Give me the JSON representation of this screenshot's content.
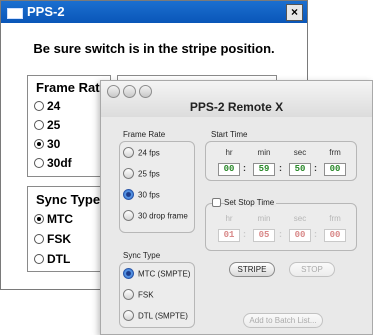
{
  "back_window": {
    "title": "PPS-2",
    "close_glyph": "×",
    "notice": "Be sure switch is in the stripe position.",
    "frame_rate": {
      "label": "Frame Rate:",
      "options": [
        "24",
        "25",
        "30",
        "30df"
      ],
      "selected": "30"
    },
    "sync_type": {
      "label": "Sync Type:",
      "options": [
        "MTC",
        "FSK",
        "DTL"
      ],
      "selected": "MTC"
    }
  },
  "front_window": {
    "title": "PPS-2 Remote X",
    "frame_rate": {
      "label": "Frame Rate",
      "options": [
        "24 fps",
        "25 fps",
        "30 fps",
        "30 drop frame"
      ],
      "selected": "30 fps"
    },
    "start_time": {
      "label": "Start Time",
      "headers": [
        "hr",
        "min",
        "sec",
        "frm"
      ],
      "values": [
        "00",
        "59",
        "50",
        "00"
      ]
    },
    "stop_time": {
      "label": "Set Stop Time",
      "checked": false,
      "headers": [
        "hr",
        "min",
        "sec",
        "frm"
      ],
      "values": [
        "01",
        "05",
        "00",
        "00"
      ]
    },
    "sync_type": {
      "label": "Sync Type",
      "options": [
        "MTC (SMPTE)",
        "FSK",
        "DTL (SMPTE)"
      ],
      "selected": "MTC (SMPTE)"
    },
    "buttons": {
      "stripe": "STRIPE",
      "stop": "STOP",
      "add_batch": "Add to Batch List..."
    }
  }
}
